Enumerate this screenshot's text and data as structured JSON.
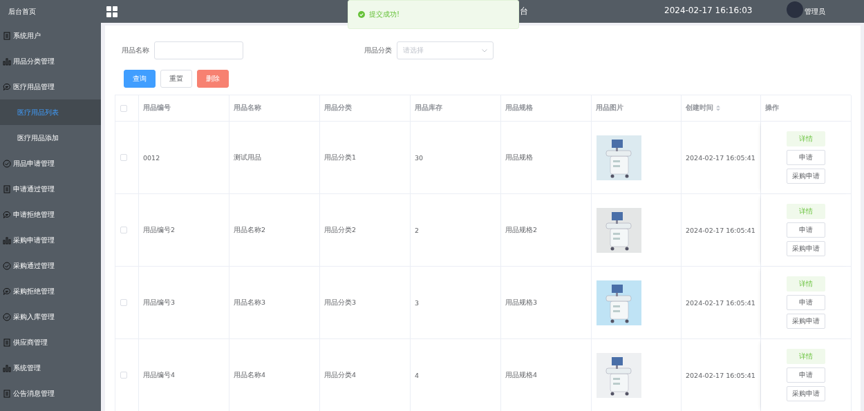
{
  "sidebar": {
    "home": "后台首页",
    "items": [
      {
        "label": "系统用户",
        "kind": "doc"
      },
      {
        "label": "用品分类管理",
        "kind": "bars"
      },
      {
        "label": "医疗用品管理",
        "kind": "chat",
        "children": [
          {
            "label": "医疗用品列表",
            "selected": true
          },
          {
            "label": "医疗用品添加",
            "selected": false
          }
        ]
      },
      {
        "label": "用品申请管理",
        "kind": "check"
      },
      {
        "label": "申请通过管理",
        "kind": "doc"
      },
      {
        "label": "申请拒绝管理",
        "kind": "chat"
      },
      {
        "label": "采购申请管理",
        "kind": "bars"
      },
      {
        "label": "采购通过管理",
        "kind": "check"
      },
      {
        "label": "采购拒绝管理",
        "kind": "chat"
      },
      {
        "label": "采购入库管理",
        "kind": "check"
      },
      {
        "label": "供应商管理",
        "kind": "doc"
      },
      {
        "label": "系统管理",
        "kind": "bars"
      },
      {
        "label": "公告消息管理",
        "kind": "doc"
      }
    ]
  },
  "header": {
    "title_visible": "台",
    "datetime": "2024-02-17 16:16:03",
    "user": "管理员"
  },
  "toast": {
    "message": "提交成功!"
  },
  "filters": [
    {
      "label": "用品名称",
      "kind": "input"
    },
    {
      "label": "用品分类",
      "kind": "select",
      "placeholder": "请选择"
    }
  ],
  "buttons": [
    {
      "label": "查询",
      "kind": "primary"
    },
    {
      "label": "重置",
      "kind": "default"
    },
    {
      "label": "删除",
      "kind": "danger"
    }
  ],
  "table": {
    "all_checked": false,
    "columns": [
      "用品编号",
      "用品名称",
      "用品分类",
      "用品库存",
      "用品规格",
      "用品图片",
      "创建时间",
      "操作"
    ],
    "rows": [
      {
        "checked": false,
        "cells": [
          "0012",
          "测试用品",
          "用品分类1",
          "30",
          "用品规格"
        ],
        "image": {
          "kind": "picture"
        },
        "created": "2024-02-17 16:05:41",
        "actions": [
          "详情",
          "申请",
          "采购申请"
        ]
      },
      {
        "checked": false,
        "cells": [
          "用品编号2",
          "用品名称2",
          "用品分类2",
          "2",
          "用品规格2"
        ],
        "image": {
          "kind": "picture"
        },
        "created": "2024-02-17 16:05:41",
        "actions": [
          "详情",
          "申请",
          "采购申请"
        ]
      },
      {
        "checked": false,
        "cells": [
          "用品编号3",
          "用品名称3",
          "用品分类3",
          "3",
          "用品规格3"
        ],
        "image": {
          "kind": "picture"
        },
        "created": "2024-02-17 16:05:41",
        "actions": [
          "详情",
          "申请",
          "采购申请"
        ]
      },
      {
        "checked": false,
        "cells": [
          "用品编号4",
          "用品名称4",
          "用品分类4",
          "4",
          "用品规格4"
        ],
        "image": {
          "kind": "picture"
        },
        "created": "2024-02-17 16:05:41",
        "actions": [
          "详情",
          "申请",
          "采购申请"
        ]
      }
    ]
  }
}
